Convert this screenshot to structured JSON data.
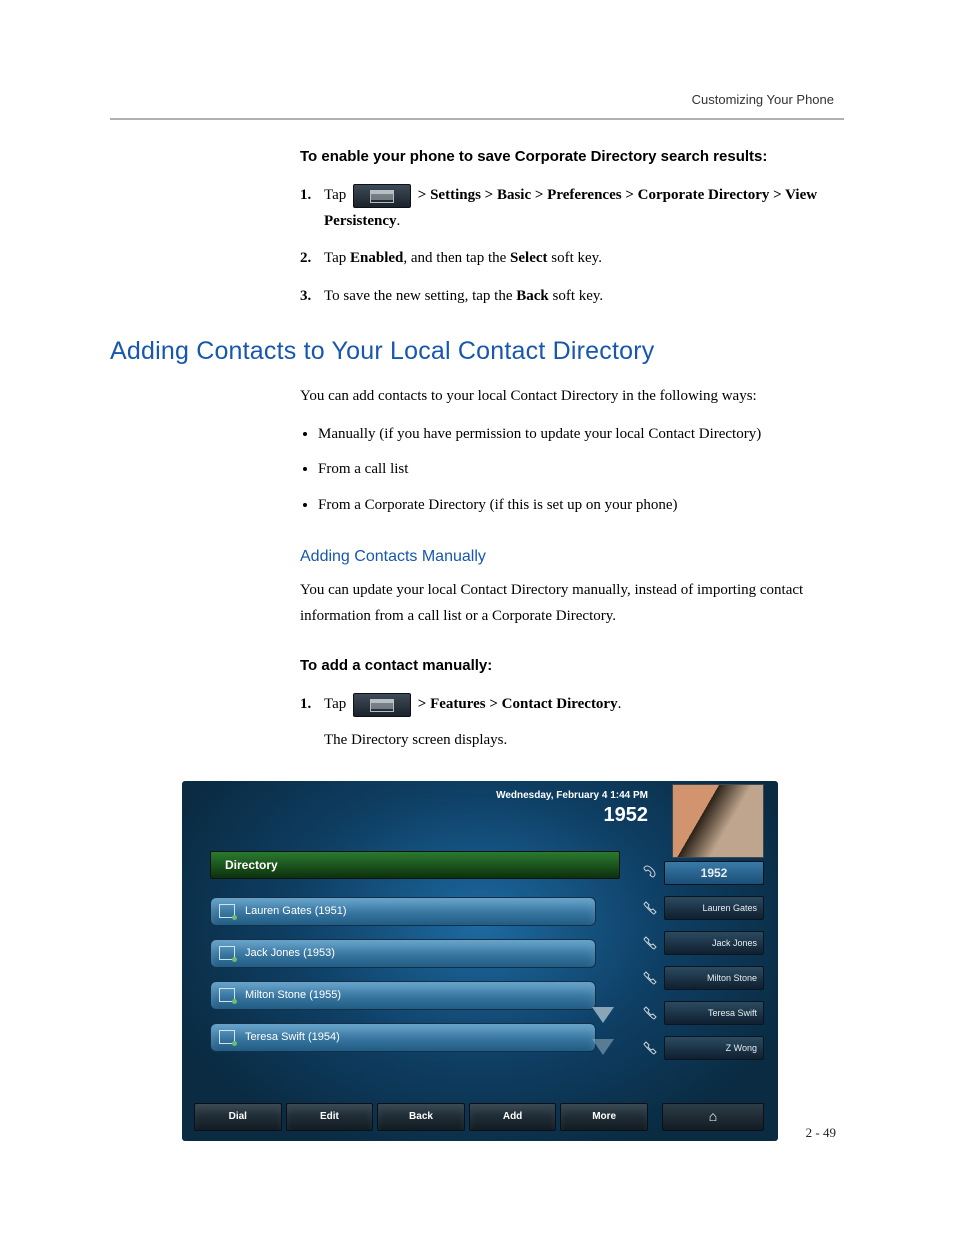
{
  "header": {
    "right": "Customizing Your Phone"
  },
  "section1": {
    "heading": "To enable your phone to save Corporate Directory search results:",
    "step1_pre": "Tap ",
    "step1_post": " > Settings > Basic > Preferences > Corporate Directory > View Persistency",
    "step1_end": ".",
    "step2_a": "Tap ",
    "step2_b": "Enabled",
    "step2_c": ", and then tap the ",
    "step2_d": "Select",
    "step2_e": " soft key.",
    "step3_a": "To save the new setting, tap the ",
    "step3_b": "Back",
    "step3_c": " soft key."
  },
  "heading2": "Adding Contacts to Your Local Contact Directory",
  "intro": "You can add contacts to your local Contact Directory in the following ways:",
  "bullets": [
    "Manually (if you have permission to update your local Contact Directory)",
    "From a call list",
    "From a Corporate Directory (if this is set up on your phone)"
  ],
  "sub_heading": "Adding Contacts Manually",
  "sub_para": "You can update your local Contact Directory manually, instead of importing contact information from a call list or a Corporate Directory.",
  "section2": {
    "heading": "To add a contact manually:",
    "step1_pre": "Tap ",
    "step1_path": " > Features > Contact Directory",
    "step1_end": ".",
    "step1_after": "The Directory screen displays."
  },
  "phone": {
    "datetime": "Wednesday, February 4  1:44 PM",
    "extension": "1952",
    "dir_title": "Directory",
    "rows": [
      "Lauren Gates (1951)",
      "Jack Jones (1953)",
      "Milton Stone (1955)",
      "Teresa Swift (1954)"
    ],
    "side_first": "1952",
    "side": [
      "Lauren Gates",
      "Jack Jones",
      "Milton Stone",
      "Teresa Swift",
      "Z Wong"
    ],
    "softkeys": [
      "Dial",
      "Edit",
      "Back",
      "Add",
      "More"
    ],
    "home_glyph": "⌂"
  },
  "page_number": "2 - 49"
}
